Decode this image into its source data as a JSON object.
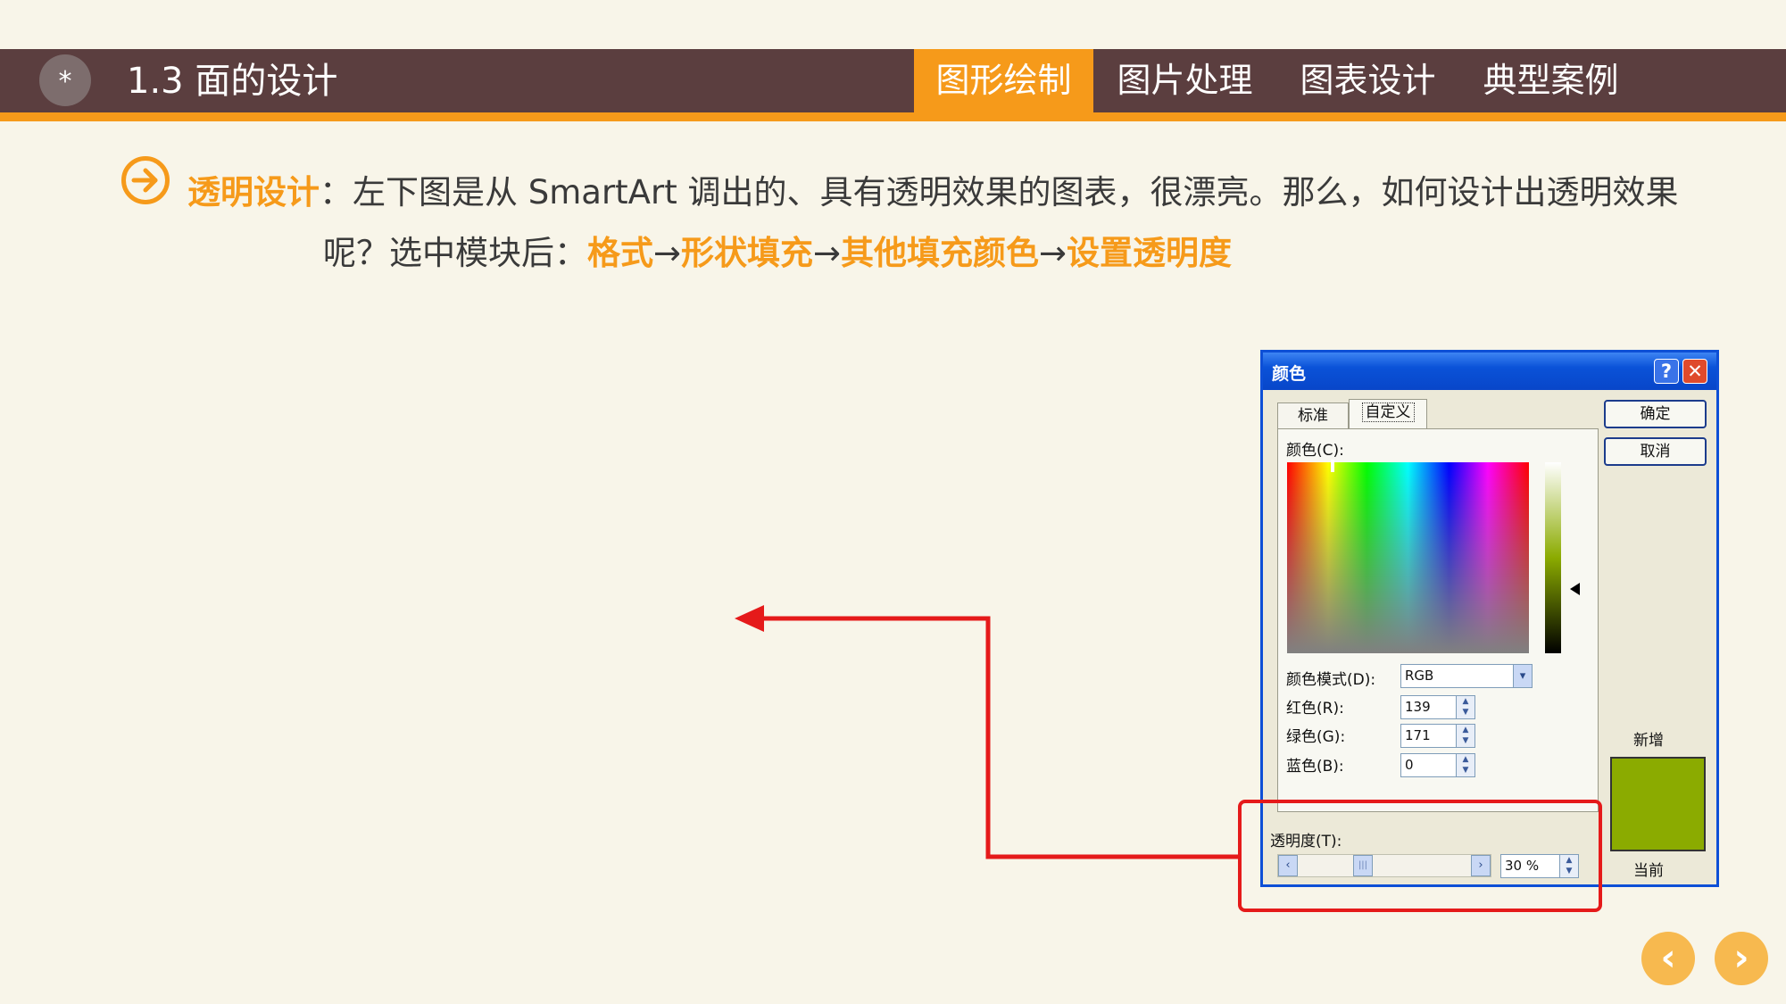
{
  "header": {
    "star": "*",
    "section_title": "1.3  面的设计",
    "nav": [
      {
        "label": "图形绘制",
        "active": true
      },
      {
        "label": "图片处理",
        "active": false
      },
      {
        "label": "图表设计",
        "active": false
      },
      {
        "label": "典型案例",
        "active": false
      }
    ]
  },
  "intro": {
    "label": "透明设计",
    "line1_rest": "：左下图是从 SmartArt 调出的、具有透明效果的图表，很漂亮。那么，如何设计出透明效果",
    "line2_prefix": "呢？选中模块后：",
    "steps": [
      "格式",
      "形状填充",
      "其他填充颜色",
      "设置透明度"
    ],
    "arrow": "→"
  },
  "dialog": {
    "title": "颜色",
    "help": "?",
    "close": "✕",
    "tabs": [
      {
        "label": "标准"
      },
      {
        "label": "自定义"
      }
    ],
    "colors_label": "颜色(C):",
    "mode_label": "颜色模式(D):",
    "mode_value": "RGB",
    "red_label": "红色(R):",
    "red_value": "139",
    "green_label": "绿色(G):",
    "green_value": "171",
    "blue_label": "蓝色(B):",
    "blue_value": "0",
    "transparency_label": "透明度(T):",
    "transparency_value": "30 %",
    "transparency_fraction": 0.3,
    "ok": "确定",
    "cancel": "取消",
    "new_label": "新增",
    "current_label": "当前",
    "swatch_color": "#8bab00"
  },
  "footer": {
    "prev": "‹",
    "next": "›"
  },
  "colors": {
    "accent": "#f69a1a",
    "header_bg": "#5b3e3f",
    "annotation_red": "#e51a1a"
  }
}
